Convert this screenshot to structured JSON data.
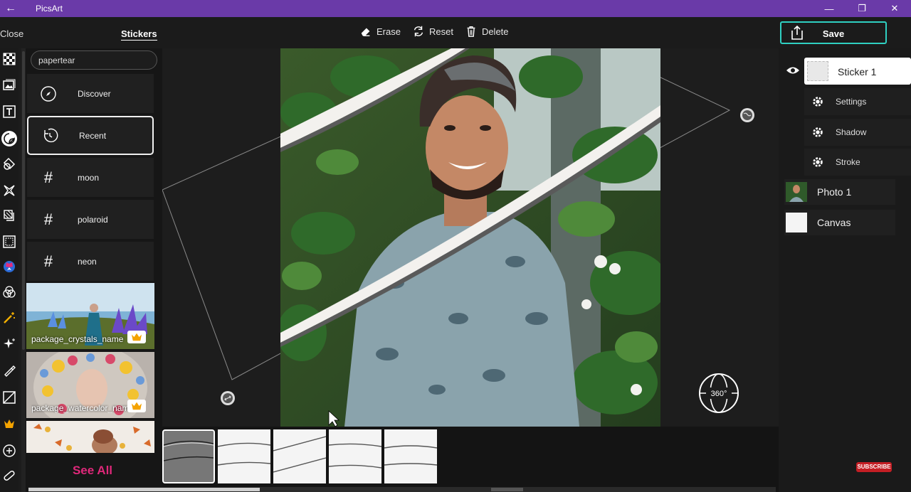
{
  "window": {
    "title": "PicsArt"
  },
  "toolbar": {
    "close_label": "Close",
    "title": "Stickers",
    "erase_label": "Erase",
    "reset_label": "Reset",
    "delete_label": "Delete",
    "save_label": "Save"
  },
  "stickers": {
    "search_value": "papertear",
    "categories": [
      {
        "label": "Discover",
        "icon": "compass-icon"
      },
      {
        "label": "Recent",
        "icon": "clock-icon"
      },
      {
        "label": "moon",
        "icon": "hashtag-icon"
      },
      {
        "label": "polaroid",
        "icon": "hashtag-icon"
      },
      {
        "label": "neon",
        "icon": "hashtag-icon"
      }
    ],
    "packages": [
      {
        "name": "package_crystals_name"
      },
      {
        "name": "package_watercolor_name"
      },
      {
        "name": ""
      }
    ],
    "see_all_label": "See All",
    "hashtag_glyph": "#"
  },
  "canvas": {
    "badge_360": "360°"
  },
  "layers": {
    "sticker": {
      "label": "Sticker 1"
    },
    "sticker_options": [
      {
        "label": "Settings"
      },
      {
        "label": "Shadow"
      },
      {
        "label": "Stroke"
      }
    ],
    "photo": {
      "label": "Photo 1"
    },
    "canvas": {
      "label": "Canvas"
    }
  },
  "overlay": {
    "subscribe_label": "SUBSCRIBE"
  },
  "colors": {
    "accent_purple": "#6a3aa8",
    "save_border": "#2fd0c2",
    "see_all_pink": "#e0287a"
  }
}
